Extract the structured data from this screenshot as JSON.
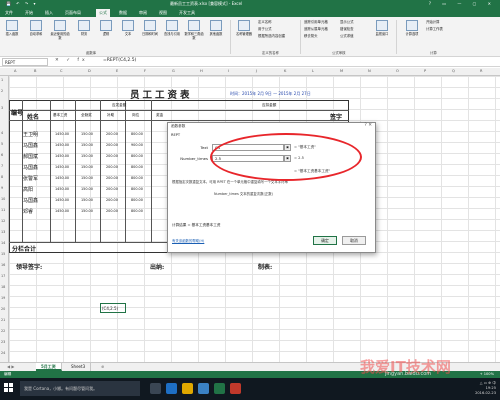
{
  "window": {
    "title": "最新员工工资表.xlsx [兼容模式] - Excel",
    "qat": "💾 ↶ ↷ ▾",
    "controls": "? ▭ — ▢ ✕"
  },
  "ribbon_tabs": [
    "文件",
    "开始",
    "插入",
    "页面布局",
    "公式",
    "数据",
    "审阅",
    "视图",
    "开发工具"
  ],
  "active_tab": "公式",
  "ribbon": {
    "buttons": [
      {
        "label": "插入函数",
        "icon": "fx-icon"
      },
      {
        "label": "自动求和",
        "icon": "sum-icon"
      },
      {
        "label": "最近使用的函数",
        "icon": "recent-icon"
      },
      {
        "label": "财务",
        "icon": "finance-icon"
      },
      {
        "label": "逻辑",
        "icon": "logic-icon"
      },
      {
        "label": "文本",
        "icon": "text-icon"
      },
      {
        "label": "日期和时间",
        "icon": "date-icon"
      },
      {
        "label": "查找与引用",
        "icon": "lookup-icon"
      },
      {
        "label": "数学和三角函数",
        "icon": "math-icon"
      },
      {
        "label": "其他函数",
        "icon": "more-icon"
      },
      {
        "label": "名称管理器",
        "icon": "name-icon"
      }
    ],
    "define_names": [
      "定义名称",
      "用于公式",
      "根据所选内容创建"
    ],
    "audit": [
      "追踪引用单元格",
      "追踪从属单元格",
      "移去箭头"
    ],
    "audit2": [
      "显示公式",
      "错误检查",
      "公式求值"
    ],
    "watch": "监视窗口",
    "calc": [
      "计算选项",
      "开始计算",
      "计算工作表"
    ],
    "groups": [
      "函数库",
      "定义的名称",
      "公式审核",
      "计算"
    ]
  },
  "formula_bar": {
    "name_box": "REPT",
    "icons": "✕ ✓ fx",
    "formula": "=REPT(C4,2.5)"
  },
  "columns": [
    "A",
    "B",
    "C",
    "D",
    "E",
    "F",
    "G",
    "H",
    "I",
    "J",
    "K",
    "L",
    "M",
    "N",
    "O",
    "P",
    "Q",
    "R"
  ],
  "rows": [
    "1",
    "2",
    "3",
    "4",
    "5",
    "6",
    "7",
    "8",
    "9",
    "10",
    "11",
    "12",
    "13",
    "14",
    "15",
    "16",
    "17",
    "18",
    "19",
    "20",
    "21",
    "22",
    "23",
    "24",
    "25"
  ],
  "sheet": {
    "title": "员工工资表",
    "date": "时间：2015年 2月 9日  — 2015年 2月 27日",
    "headers": {
      "num": "编号",
      "name": "姓名",
      "should_pay": "应发金额",
      "deduct": "应扣金额",
      "sign": "签字",
      "basic": "基本工资",
      "full": "全勤奖",
      "allowance": "补助",
      "post": "岗位",
      "bonus": "奖金"
    },
    "employees": [
      "王卫明",
      "马国鑫",
      "郝国斌",
      "马国鑫",
      "张警军",
      "高阳",
      "马国鑫",
      "邓睿"
    ],
    "basic_values": [
      "1450.00",
      "1450.00",
      "1450.00",
      "1450.00",
      "1450.00",
      "1450.00",
      "1450.00",
      "1450.00"
    ],
    "full_values": [
      "150.00",
      "150.00",
      "150.00",
      "150.00",
      "150.00",
      "150.00",
      "150.00",
      "150.00"
    ],
    "allowance_values": [
      "200.00",
      "200.00",
      "200.00",
      "200.00",
      "200.00",
      "200.00",
      "200.00",
      "200.00"
    ],
    "post_values": [
      "800.00",
      "900.00",
      "800.00",
      "800.00",
      "800.00",
      "800.00",
      "800.00",
      "800.00"
    ],
    "subtotal": "分栏合计",
    "leader_sign": "领导签字:",
    "cashier": "出纳:",
    "preparer": "制表:",
    "cell_formula": "(C4,2.5)"
  },
  "dialog": {
    "title": "函数参数",
    "close": "?  ✕",
    "function": "REPT",
    "arg1_label": "Text",
    "arg1_value": "C4",
    "arg1_result": "= \"基本工资\"",
    "arg2_label": "Number_times",
    "arg2_value": "2.5",
    "arg2_result": "= 2.5",
    "overall_result": "= \"基本工资基本工资\"",
    "description": "根据指定次数重复文本。可用 RPET 在一个单元格中重复填写一个文本字符串",
    "arg_description": "Number_times  文本的重复次数(正数)",
    "calc_result": "计算结果 =  基本工资基本工资",
    "help_link": "有关该函数的帮助(H)",
    "ok": "确定",
    "cancel": "取消",
    "highlight_color": "#e8262b"
  },
  "sheet_tabs": [
    "5月工资",
    "Sheet3"
  ],
  "sheet_tab_add": "⊕",
  "status": {
    "left": "编辑",
    "zoom": "+ 100%"
  },
  "taskbar": {
    "search": "我是 Cortana，小娜。有问题尽管问我。",
    "tray_line1": "△ ▭ ⊕ 中",
    "time": "19:25",
    "date": "2016-02-23"
  },
  "watermark": {
    "main": "我爱IT技术网",
    "sub": "jingyan.baidu.com"
  },
  "colors": {
    "excel_green": "#217346",
    "ellipse": "#e8262b"
  }
}
